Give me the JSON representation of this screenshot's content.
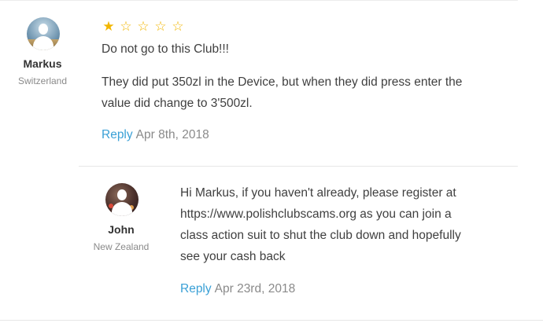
{
  "reviews": [
    {
      "author": "Markus",
      "location": "Switzerland",
      "rating": 1,
      "max_rating": 5,
      "star_icons": [
        "star-filled",
        "star-empty",
        "star-empty",
        "star-empty",
        "star-empty"
      ],
      "title": "Do not go to this Club!!!",
      "body_line1": "They did put 350zl in the Device, but when they did press enter the",
      "body_line2": "value did change to 3'500zl.",
      "reply_label": "Reply",
      "date": "Apr 8th, 2018"
    }
  ],
  "replies": [
    {
      "author": "John",
      "location": "New Zealand",
      "line1": "Hi Markus, if you haven't already, please register at",
      "line2": "https://www.polishclubscams.org as you can join a",
      "line3": "class action suit to shut the club down and hopefully",
      "line4": "see your cash back",
      "reply_label": "Reply",
      "date": "Apr 23rd, 2018"
    }
  ],
  "colors": {
    "star": "#f2b600",
    "link": "#3aa0d6",
    "text": "#3f3f3f",
    "muted": "#8a8a8a"
  }
}
